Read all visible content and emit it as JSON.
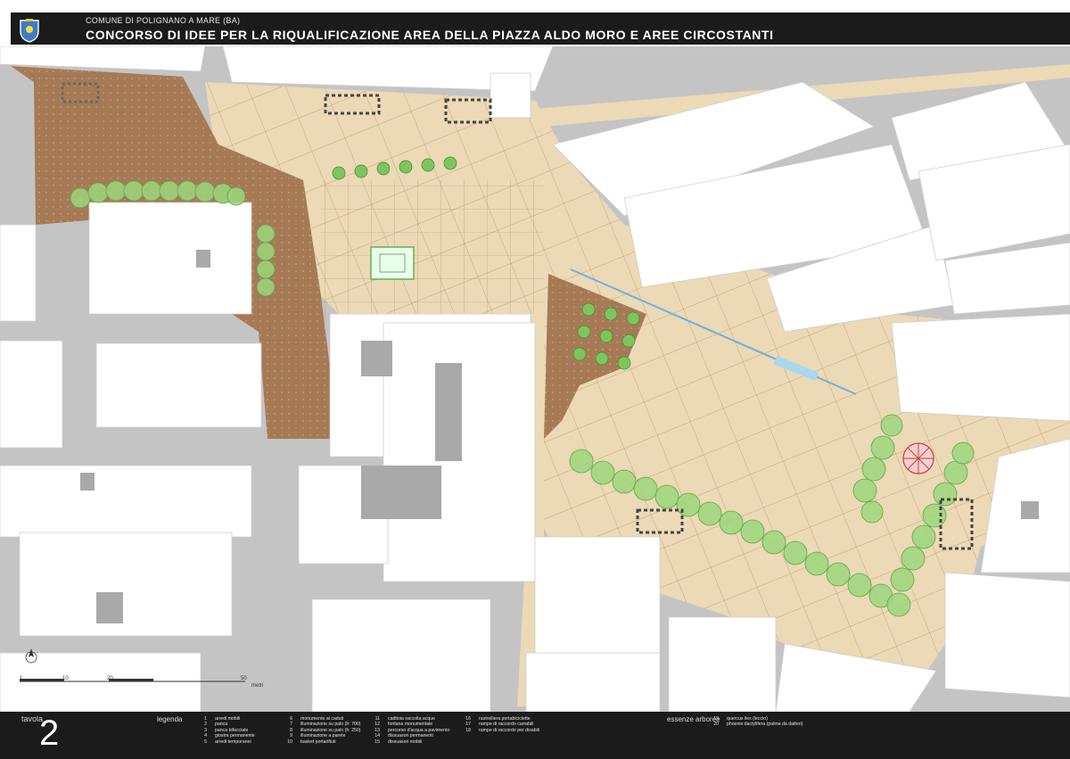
{
  "header": {
    "municipality": "COMUNE DI POLIGNANO A MARE (BA)",
    "title": "CONCORSO DI IDEE PER LA RIQUALIFICAZIONE AREA DELLA PIAZZA ALDO MORO E AREE CIRCOSTANTI"
  },
  "scale_bar": {
    "ticks": [
      "1",
      "10",
      "20",
      "50"
    ],
    "unit": "metri"
  },
  "footer": {
    "tavola_label": "tavola",
    "tavola_number": "2",
    "legend_label": "legenda",
    "legend_items": [
      {
        "num": "1",
        "text": "arredi mobili"
      },
      {
        "num": "2",
        "text": "panca"
      },
      {
        "num": "3",
        "text": "panca bifacciale"
      },
      {
        "num": "4",
        "text": "giostra permanente"
      },
      {
        "num": "5",
        "text": "arredi temporanei"
      },
      {
        "num": "6",
        "text": "monumento ai caduti"
      },
      {
        "num": "7",
        "text": "illuminazione su palo (h: 700)"
      },
      {
        "num": "8",
        "text": "illuminazione su palo (h: 250)"
      },
      {
        "num": "9",
        "text": "illuminazione a parete"
      },
      {
        "num": "10",
        "text": "basket portarifiuti"
      },
      {
        "num": "11",
        "text": "caditoia raccolta acque"
      },
      {
        "num": "12",
        "text": "fontana monumentale"
      },
      {
        "num": "13",
        "text": "percorso d'acqua a pavimento"
      },
      {
        "num": "14",
        "text": "dissuasori permanenti"
      },
      {
        "num": "15",
        "text": "dissuasori mobili"
      },
      {
        "num": "16",
        "text": "rastrelliera portabiciclette"
      },
      {
        "num": "17",
        "text": "rampe di raccordo carrabili"
      },
      {
        "num": "18",
        "text": "rampe di raccordo per disabili"
      }
    ],
    "essenze_label": "essenze arboree",
    "essenze_items": [
      {
        "num": "19",
        "text": "quercus ilex (leccio)"
      },
      {
        "num": "20",
        "text": "phoenix dactylifera (palma da datteri)"
      }
    ]
  },
  "colors": {
    "pavement_light": "#ecd9b5",
    "pavement_brown": "#a67a55",
    "road": "#bdbdbd",
    "building": "#ffffff",
    "tree": "#9cd67c",
    "header_bg": "#1b1b1b"
  }
}
